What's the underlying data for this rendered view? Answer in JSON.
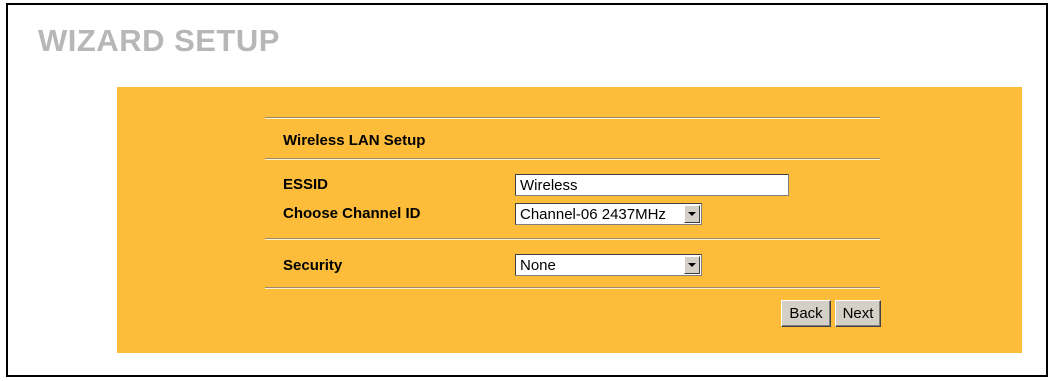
{
  "page": {
    "title": "WIZARD SETUP"
  },
  "form": {
    "section_title": "Wireless LAN Setup",
    "essid": {
      "label": "ESSID",
      "value": "Wireless"
    },
    "channel": {
      "label": "Choose Channel ID",
      "selected": "Channel-06 2437MHz"
    },
    "security": {
      "label": "Security",
      "selected": "None"
    }
  },
  "buttons": {
    "back": "Back",
    "next": "Next"
  },
  "colors": {
    "panel": "#fdbd3a",
    "title": "#b7b7b7",
    "button_face": "#d4d0c8"
  }
}
